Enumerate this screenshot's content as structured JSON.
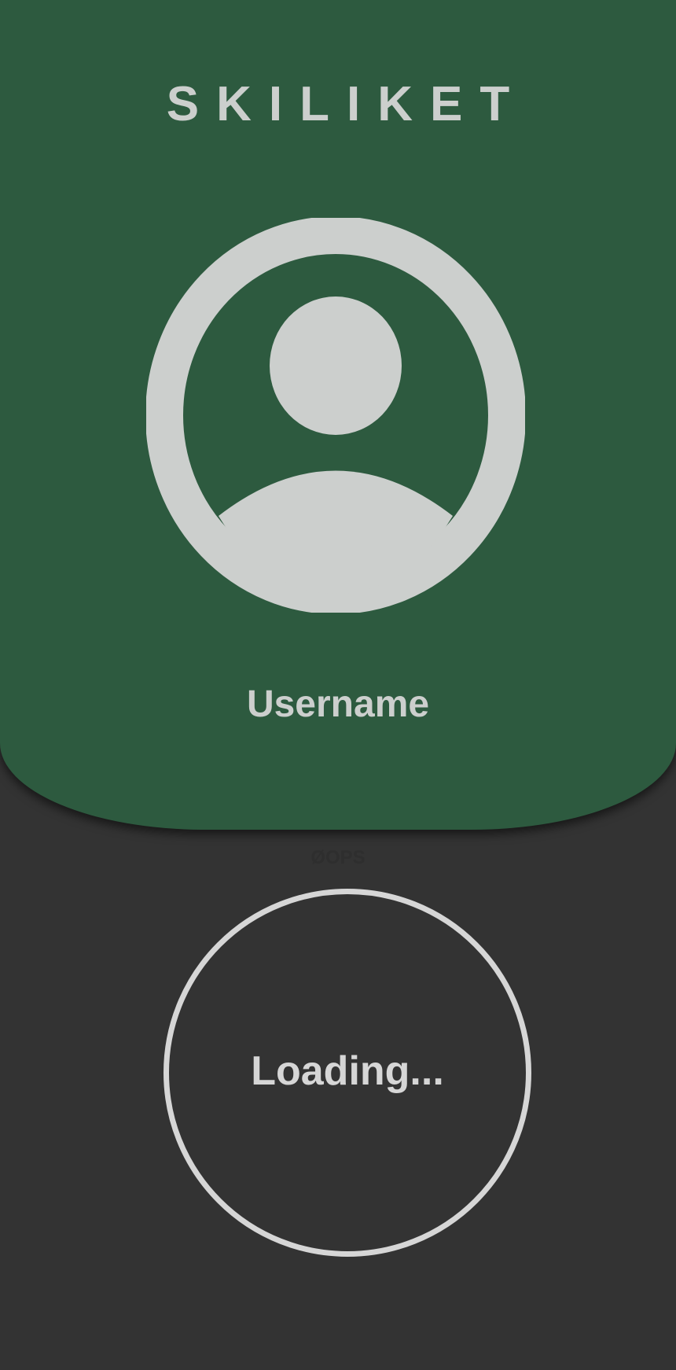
{
  "app": {
    "title": "SKILIKET"
  },
  "profile": {
    "avatar_icon": "account-circle-icon",
    "username": "Username"
  },
  "status": {
    "faint_label": "ØOPS",
    "loading_label": "Loading..."
  },
  "colors": {
    "header_background": "#2d5a3f",
    "page_background": "#333333",
    "foreground": "#cccfcd",
    "ring": "#d6d6d6"
  }
}
